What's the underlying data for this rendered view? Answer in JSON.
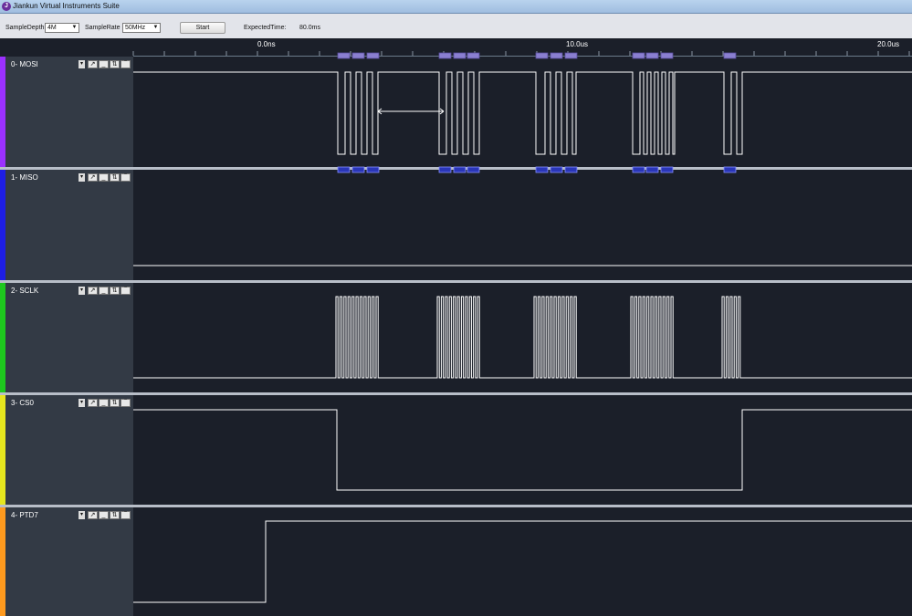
{
  "window": {
    "title": "Jiankun Virtual Instruments Suite",
    "icon": "app-logo-icon"
  },
  "toolbar": {
    "sample_depth_label": "SampleDepth",
    "sample_depth_value": "4M",
    "sample_rate_label": "SampleRate",
    "sample_rate_value": "50MHz",
    "start_label": "Start",
    "expected_time_label": "ExpectedTime:",
    "expected_time_value": "80.0ms"
  },
  "ruler": {
    "ticks": [
      "0.0ns",
      "10.0us",
      "20.0us"
    ]
  },
  "channels": [
    {
      "name": "0- MOSI",
      "color": "#9b30ff"
    },
    {
      "name": "1- MISO",
      "color": "#1e1ee6"
    },
    {
      "name": "2- SCLK",
      "color": "#1ec81e"
    },
    {
      "name": "3- CS0",
      "color": "#e6e61e"
    },
    {
      "name": "4- PTD7",
      "color": "#ff9a1e"
    }
  ],
  "channel_controls": [
    "rising-edge-trigger-icon",
    "low-level-icon",
    "any-edge-trigger-icon",
    "high-level-icon"
  ],
  "colors": {
    "background": "#1b1f29",
    "panel": "#333a45",
    "waveform": "#ffffff",
    "decode_marker": "#8a7fd0"
  }
}
